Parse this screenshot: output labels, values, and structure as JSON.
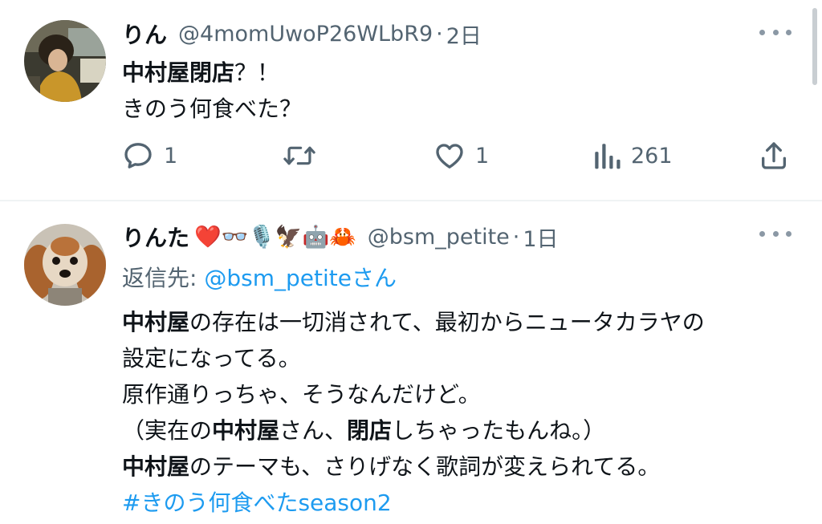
{
  "tweets": [
    {
      "name": "りん",
      "handle": "@4momUwoP26WLbR9",
      "dot": "·",
      "time": "2日",
      "lines": [
        {
          "bold": "中村屋閉店",
          "text": "？！"
        },
        {
          "text": "きのう何食べた？"
        }
      ],
      "actions": {
        "reply_count": "1",
        "like_count": "1",
        "views_count": "261"
      }
    },
    {
      "name": "りんた",
      "emojis": "❤️👓🎙️🦅🤖🦀",
      "handle": "@bsm_petite",
      "dot": "·",
      "time": "1日",
      "reply_to_prefix": "返信先: ",
      "reply_to_mention": "@bsm_petite",
      "reply_to_suffix": "さん",
      "body": {
        "l1_b": "中村屋",
        "l1_t": "の存在は一切消されて、最初からニュータカラヤの",
        "l2_t": "設定になってる。",
        "l3_t": "原作通りっちゃ、そうなんだけど。",
        "l4_a": "（実在の",
        "l4_b": "中村屋",
        "l4_c": "さん、",
        "l4_d": "閉店",
        "l4_e": "しちゃったもんね。）",
        "l5_b": "中村屋",
        "l5_t": "のテーマも、さりげなく歌詞が変えられてる。",
        "hashtag": "#きのう何食べたseason2"
      }
    }
  ],
  "icons": {
    "reply": "reply-icon",
    "retweet": "retweet-icon",
    "like": "heart-icon",
    "views": "views-icon",
    "share": "share-icon",
    "more": "more-icon"
  },
  "colors": {
    "text": "#0f1419",
    "secondary": "#536471",
    "link": "#1d9bf0"
  }
}
